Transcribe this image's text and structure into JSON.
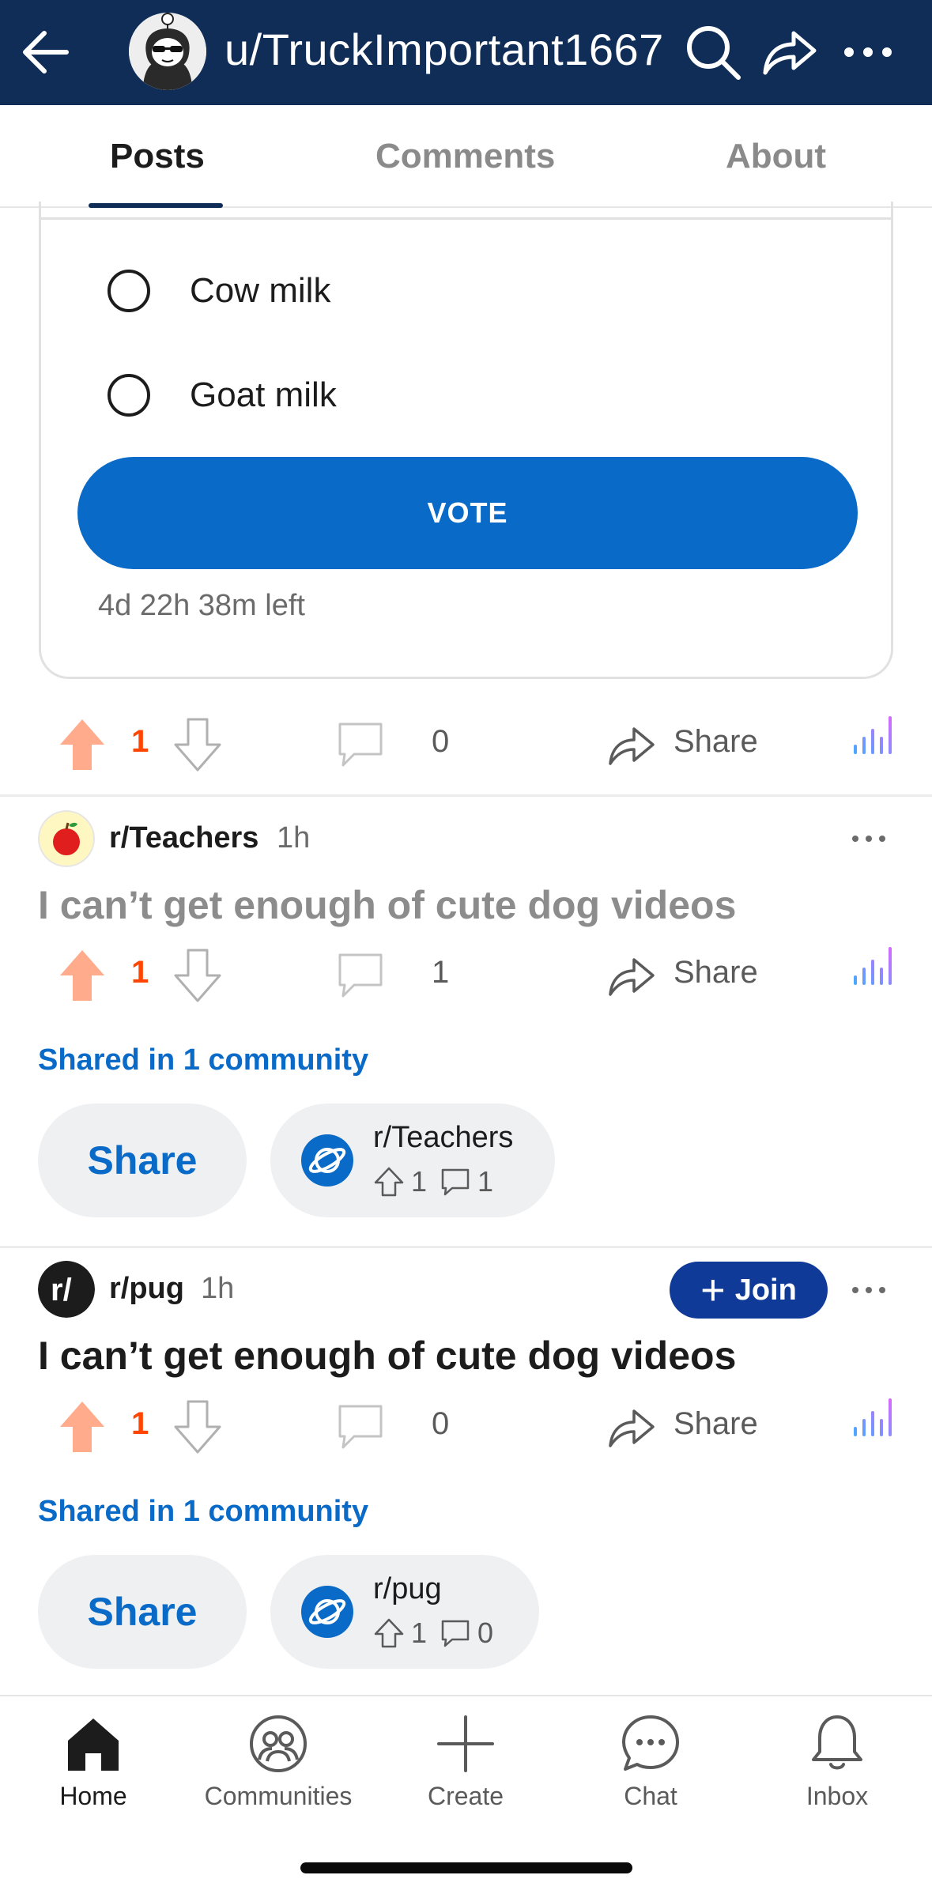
{
  "header": {
    "title": "u/TruckImportant1667"
  },
  "tabs": [
    {
      "label": "Posts",
      "active": true
    },
    {
      "label": "Comments",
      "active": false
    },
    {
      "label": "About",
      "active": false
    }
  ],
  "poll": {
    "options": [
      "Cow milk",
      "Goat milk"
    ],
    "vote_label": "VOTE",
    "time_left": "4d 22h 38m left"
  },
  "posts": [
    {
      "votes": "1",
      "comments": "0",
      "share_label": "Share"
    },
    {
      "subreddit": "r/Teachers",
      "time": "1h",
      "title": "I can’t get enough of cute dog videos",
      "votes": "1",
      "comments": "1",
      "share_label": "Share",
      "shared_in": "Shared in 1 community",
      "share_button": "Share",
      "community": {
        "name": "r/Teachers",
        "upvotes": "1",
        "comments": "1"
      }
    },
    {
      "subreddit": "r/pug",
      "time": "1h",
      "join_label": "Join",
      "title": "I can’t get enough of cute dog videos",
      "votes": "1",
      "comments": "0",
      "share_label": "Share",
      "shared_in": "Shared in 1 community",
      "share_button": "Share",
      "community": {
        "name": "r/pug",
        "upvotes": "1",
        "comments": "0"
      }
    }
  ],
  "bottom_nav": [
    {
      "label": "Home",
      "icon": "home-icon",
      "active": true
    },
    {
      "label": "Communities",
      "icon": "communities-icon",
      "active": false
    },
    {
      "label": "Create",
      "icon": "plus-icon",
      "active": false
    },
    {
      "label": "Chat",
      "icon": "chat-icon",
      "active": false
    },
    {
      "label": "Inbox",
      "icon": "bell-icon",
      "active": false
    }
  ],
  "colors": {
    "header_bg": "#0f2d57",
    "accent_blue": "#0a6ac7",
    "upvote_orange": "#ff4500",
    "join_bg": "#0f3a98"
  }
}
